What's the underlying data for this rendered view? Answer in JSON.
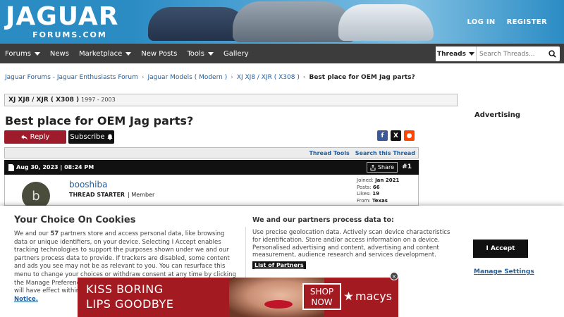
{
  "header": {
    "logo_main": "JAGUAR",
    "logo_sub": "FORUMS.COM",
    "login_label": "LOG IN",
    "register_label": "REGISTER"
  },
  "nav": {
    "items": [
      {
        "label": "Forums",
        "dropdown": true
      },
      {
        "label": "News",
        "dropdown": false
      },
      {
        "label": "Marketplace",
        "dropdown": true
      },
      {
        "label": "New Posts",
        "dropdown": false
      },
      {
        "label": "Tools",
        "dropdown": true
      },
      {
        "label": "Gallery",
        "dropdown": false
      }
    ],
    "search_scope": "Threads",
    "search_placeholder": "Search Threads..."
  },
  "breadcrumb": {
    "items": [
      "Jaguar Forums - Jaguar Enthusiasts Forum",
      "Jaguar Models ( Modern )",
      "XJ XJ8 / XJR ( X308 )"
    ],
    "current": "Best place for OEM Jag parts?"
  },
  "forum": {
    "name": "XJ XJ8 / XJR ( X308 )",
    "years": "1997 - 2003"
  },
  "thread": {
    "title": "Best place for OEM Jag parts?",
    "reply_label": "Reply",
    "subscribe_label": "Subscribe",
    "tools_label": "Thread Tools",
    "search_label": "Search this Thread",
    "advertising_label": "Advertising"
  },
  "share_icons": [
    "facebook-icon",
    "x-icon",
    "reddit-icon"
  ],
  "post": {
    "date": "Aug 30, 2023 | 08:24 PM",
    "share_label": "Share",
    "number": "#1",
    "avatar_letter": "b",
    "username": "booshiba",
    "role": "THREAD STARTER",
    "rank": "Member",
    "stats": {
      "joined_label": "Joined:",
      "joined": "Jan 2021",
      "posts_label": "Posts:",
      "posts": "66",
      "likes_label": "Likes:",
      "likes": "19",
      "from_label": "From:",
      "from": "Texas"
    }
  },
  "cookie": {
    "title": "Your Choice On Cookies",
    "text_pre": "We and our ",
    "partner_count": "57",
    "text_post": " partners store and access personal data, like browsing data or unique identifiers, on your device. Selecting I Accept enables tracking technologies to support the purposes shown under we and our partners process data to provide. If trackers are disabled, some content and ads you see may not be as relevant to you. You can resurface this menu to change your choices or withdraw consent at any time by clicking the Manage Preferences link on the bottom of the webpage. Your choices will have effect within our Website. For more details, refer to",
    "policy_link": "our Cookie Notice.",
    "title2": "We and our partners process data to:",
    "text2": "Use precise geolocation data. Actively scan device characteristics for identification. Store and/or access information on a device. Personalised advertising and content, advertising and content measurement, audience research and services development.",
    "partners_link": "List of Partners",
    "accept_label": "I Accept",
    "manage_label": "Manage Settings"
  },
  "ad": {
    "line1": "KISS BORING",
    "line2": "LIPS GOODBYE",
    "shop1": "SHOP",
    "shop2": "NOW",
    "brand": "macys",
    "close": "×"
  }
}
